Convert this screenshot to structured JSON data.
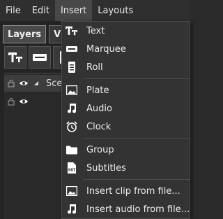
{
  "menubar": {
    "items": [
      "File",
      "Edit",
      "Insert",
      "Layouts"
    ]
  },
  "panel": {
    "tabs": [
      "Layers",
      "V"
    ],
    "layers": [
      {
        "name": "Sce"
      },
      {
        "name": ""
      }
    ]
  },
  "insert_menu": {
    "items": [
      {
        "label": "Text",
        "icon": "text-icon"
      },
      {
        "label": "Marquee",
        "icon": "marquee-icon"
      },
      {
        "label": "Roll",
        "icon": "roll-icon"
      },
      {
        "label": "Plate",
        "icon": "image-icon"
      },
      {
        "label": "Audio",
        "icon": "music-note-icon"
      },
      {
        "label": "Clock",
        "icon": "alarm-clock-icon"
      },
      {
        "label": "Group",
        "icon": "folder-icon"
      },
      {
        "label": "Subtitles",
        "icon": "subtitles-icon"
      },
      {
        "label": "Insert clip from file...",
        "icon": "image-file-icon"
      },
      {
        "label": "Insert audio from file...",
        "icon": "music-file-icon"
      }
    ]
  },
  "colors": {
    "menu_bg": "#333333",
    "menubar_bg": "#2f2f2f",
    "active_menu": "#484848",
    "workspace_bg": "#242424"
  }
}
